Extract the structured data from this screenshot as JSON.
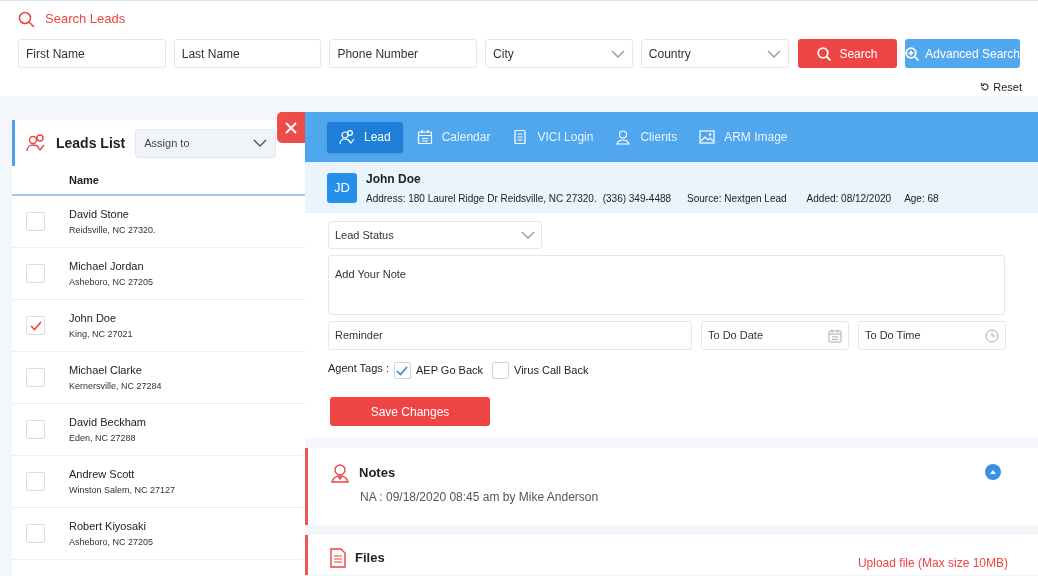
{
  "search": {
    "title": "Search Leads",
    "fields": [
      {
        "placeholder": "First Name",
        "kind": "text"
      },
      {
        "placeholder": "Last Name",
        "kind": "text"
      },
      {
        "placeholder": "Phone Number",
        "kind": "text"
      },
      {
        "placeholder": "City",
        "kind": "select"
      },
      {
        "placeholder": "Country",
        "kind": "select"
      }
    ],
    "search_button": "Search",
    "advanced_button": "Advanced Search",
    "reset": "Reset"
  },
  "leads_list": {
    "title": "Leads List",
    "assign": {
      "placeholder": "Assign to"
    },
    "column": "Name",
    "rows": [
      {
        "name": "David Stone",
        "location": "Reidsville, NC 27320.",
        "checked": false
      },
      {
        "name": "Michael Jordan",
        "location": "Asheboro, NC 27205",
        "checked": false
      },
      {
        "name": "John Doe",
        "location": "King, NC 27021",
        "checked": true
      },
      {
        "name": "Michael Clarke",
        "location": "Kernersville, NC 27284",
        "checked": false
      },
      {
        "name": "David Beckham",
        "location": "Eden, NC 27288",
        "checked": false
      },
      {
        "name": "Andrew Scott",
        "location": "Winston Salem, NC 27127",
        "checked": false
      },
      {
        "name": "Robert Kiyosaki",
        "location": "Asheboro, NC 27205",
        "checked": false
      }
    ]
  },
  "tabs": [
    {
      "label": "Lead",
      "kind": "lead",
      "selected": true
    },
    {
      "label": "Calendar",
      "kind": "calendar",
      "selected": false
    },
    {
      "label": "VICI Login",
      "kind": "doc",
      "selected": false
    },
    {
      "label": "Clients",
      "kind": "person",
      "selected": false
    },
    {
      "label": "ARM Image",
      "kind": "image",
      "selected": false
    }
  ],
  "lead": {
    "initials": "JD",
    "name": "John Doe",
    "address": "Address: 180 Laurel Ridge Dr Reidsville, NC 27320.",
    "phone": "(336) 349-4488",
    "source": "Source: Nextgen Lead",
    "added": "Added: 08/12/2020",
    "age": "Age: 68"
  },
  "form": {
    "status": {
      "placeholder": "Lead Status"
    },
    "note": {
      "placeholder": "Add Your Note"
    },
    "reminder": {
      "placeholder": "Reminder"
    },
    "date": {
      "placeholder": "To Do Date"
    },
    "time": {
      "placeholder": "To Do Time"
    },
    "tags_label": "Agent Tags :",
    "tags": [
      {
        "label": "AEP Go Back",
        "checked": true
      },
      {
        "label": "Virus Call Back",
        "checked": false
      }
    ],
    "save": "Save Changes"
  },
  "notes": {
    "title": "Notes",
    "expanded": true,
    "entries": [
      "NA : 09/18/2020 08:45 am by Mike Anderson"
    ]
  },
  "files": {
    "title": "Files",
    "upload": "Upload file (Max size 10MB)"
  }
}
